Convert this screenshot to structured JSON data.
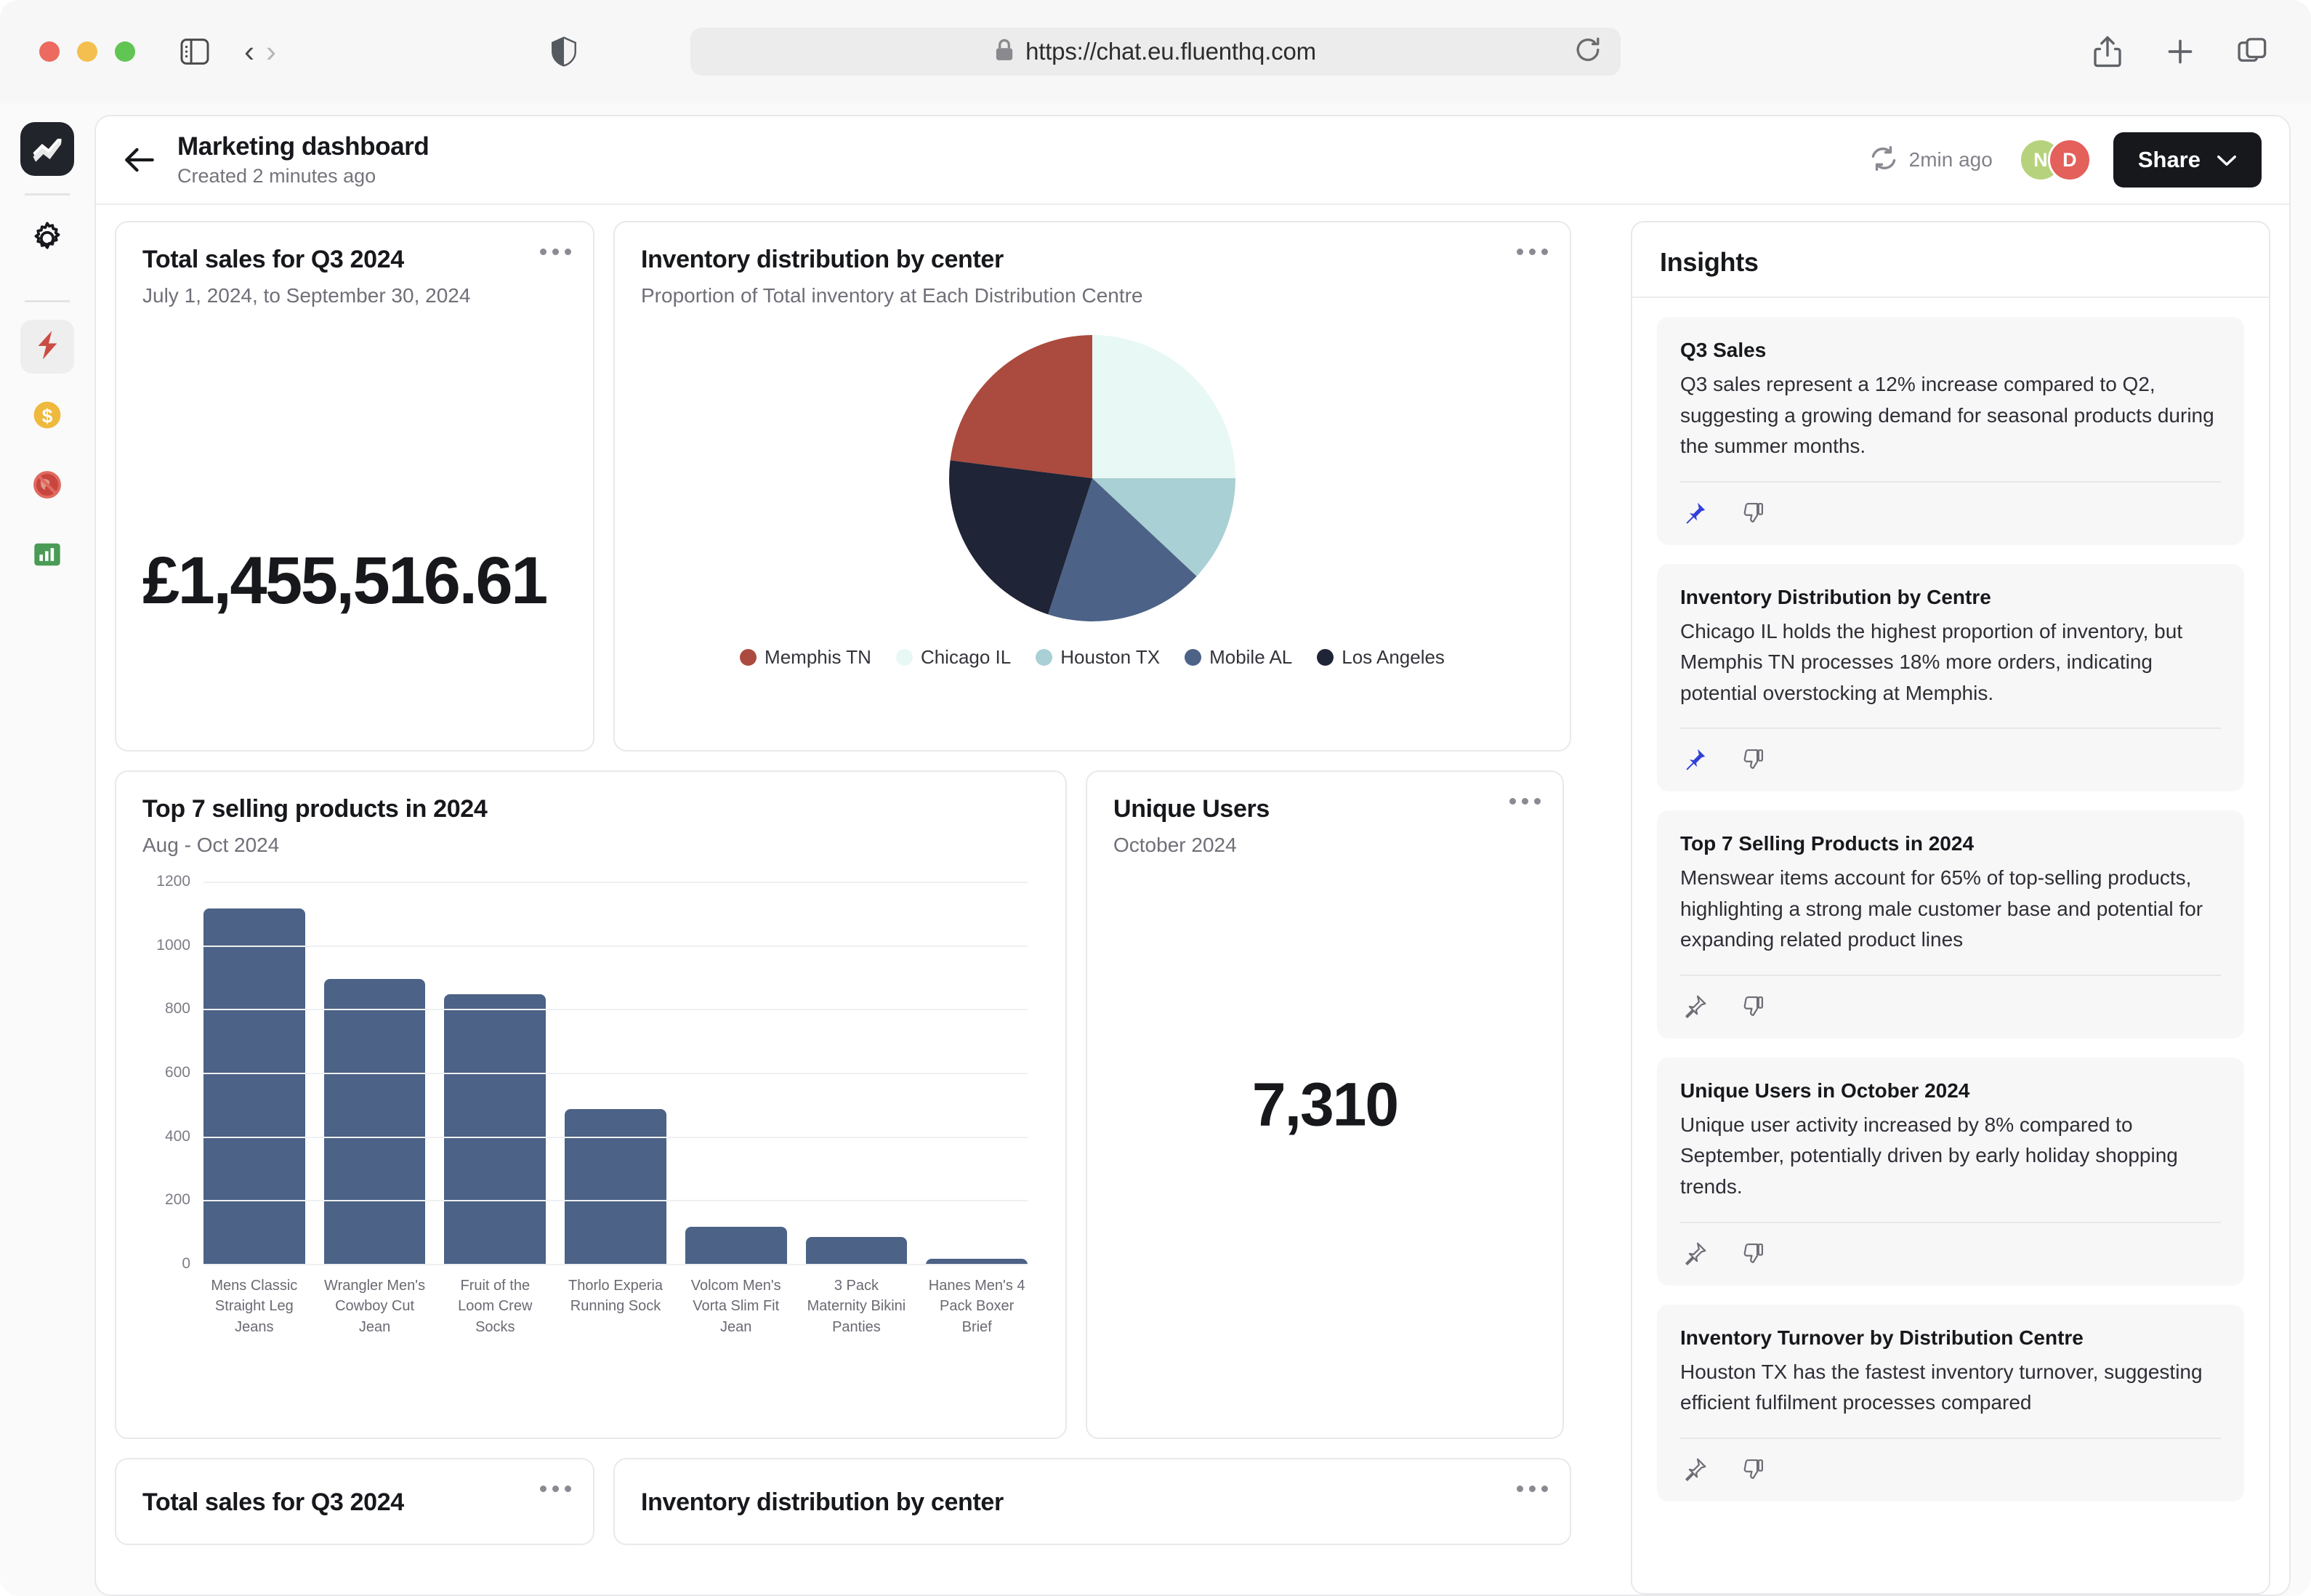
{
  "browser": {
    "url": "https://chat.eu.fluenthq.com",
    "lock_icon": "lock-icon",
    "reload_icon": "reload-icon",
    "shield_icon": "shield-icon",
    "sidebar_icon": "sidebar-toggle-icon",
    "back_icon": "chevron-left-icon",
    "forward_icon": "chevron-right-icon",
    "share_icon": "share-icon",
    "new_tab_icon": "plus-icon",
    "tabs_icon": "tab-overview-icon"
  },
  "rail": {
    "logo_icon": "fluent-logo-icon",
    "items": [
      {
        "icon": "gear-icon",
        "name": "settings",
        "active": false
      },
      {
        "icon": "lightning-bolt-icon",
        "name": "automations",
        "active": true
      },
      {
        "icon": "dollar-coin-icon",
        "name": "finance",
        "active": false
      },
      {
        "icon": "globe-restricted-icon",
        "name": "regions",
        "active": false
      },
      {
        "icon": "bar-chart-icon",
        "name": "analytics",
        "active": false
      }
    ]
  },
  "header": {
    "back_icon": "arrow-left-icon",
    "title": "Marketing dashboard",
    "subtitle": "Created 2 minutes ago",
    "refresh_icon": "refresh-icon",
    "refresh_label": "2min ago",
    "avatars": [
      {
        "initial": "N",
        "color": "#b7d27c"
      },
      {
        "initial": "D",
        "color": "#e4605a"
      }
    ],
    "share_label": "Share",
    "share_chevron": "chevron-down-icon"
  },
  "cards": {
    "total_sales": {
      "title": "Total sales for Q3 2024",
      "subtitle": "July 1, 2024, to September 30, 2024",
      "value": "£1,455,516.61",
      "menu_icon": "more-options-icon"
    },
    "inventory": {
      "title": "Inventory distribution by center",
      "subtitle": "Proportion of Total inventory at Each Distribution Centre",
      "menu_icon": "more-options-icon"
    },
    "top_products": {
      "title": "Top 7 selling products in 2024",
      "subtitle": "Aug - Oct 2024"
    },
    "unique_users": {
      "title": "Unique Users",
      "subtitle": "October 2024",
      "value": "7,310",
      "menu_icon": "more-options-icon"
    },
    "stub_total_sales": {
      "title": "Total sales for Q3 2024",
      "menu_icon": "more-options-icon"
    },
    "stub_inventory": {
      "title": "Inventory distribution by center",
      "menu_icon": "more-options-icon"
    }
  },
  "chart_data": [
    {
      "type": "pie",
      "title": "Inventory distribution by center",
      "subtitle": "Proportion of Total inventory at Each Distribution Centre",
      "legend_position": "bottom",
      "labels": [
        "Memphis TN",
        "Chicago IL",
        "Houston TX",
        "Mobile AL",
        "Los Angeles"
      ],
      "values": [
        23,
        25,
        12,
        18,
        22
      ],
      "colors": [
        "#ab4a3e",
        "#e8f8f4",
        "#a9d0d4",
        "#4c6286",
        "#1f2436"
      ],
      "slice_order_clockwise_from_top": [
        "Chicago IL",
        "Houston TX",
        "Mobile AL",
        "Los Angeles",
        "Memphis TN"
      ]
    },
    {
      "type": "bar",
      "title": "Top 7 selling products in 2024",
      "subtitle": "Aug - Oct 2024",
      "categories": [
        "Mens Classic Straight Leg Jeans",
        "Wrangler Men's Cowboy Cut Jean",
        "Fruit of the Loom Crew Socks",
        "Thorlo Experia Running Sock",
        "Volcom Men's Vorta Slim Fit Jean",
        "3 Pack Maternity Bikini Panties",
        "Hanes Men's 4 Pack Boxer Brief"
      ],
      "values": [
        1120,
        900,
        850,
        490,
        120,
        90,
        20
      ],
      "ylim": [
        0,
        1200
      ],
      "yticks": [
        0,
        200,
        400,
        600,
        800,
        1000,
        1200
      ],
      "xlabel": "",
      "ylabel": "",
      "grid": true,
      "bar_color": "#4c6286"
    }
  ],
  "insights": {
    "title": "Insights",
    "items": [
      {
        "title": "Q3 Sales",
        "body": "Q3 sales represent a 12% increase compared to Q2, suggesting a growing demand for seasonal products during the summer months.",
        "pinned": true,
        "pin_icon": "pin-icon",
        "dislike_icon": "thumbs-down-icon"
      },
      {
        "title": "Inventory Distribution by Centre",
        "body": "Chicago IL holds the highest proportion of inventory, but Memphis TN processes 18% more orders, indicating potential overstocking at Memphis.",
        "pinned": true,
        "pin_icon": "pin-icon",
        "dislike_icon": "thumbs-down-icon"
      },
      {
        "title": "Top 7 Selling Products in 2024",
        "body": "Menswear items account for 65% of top-selling products, highlighting a strong male customer base and potential for expanding related product lines",
        "pinned": false,
        "pin_icon": "pin-icon",
        "dislike_icon": "thumbs-down-icon"
      },
      {
        "title": "Unique Users in October 2024",
        "body": "Unique user activity increased by 8% compared to September, potentially driven by early holiday shopping trends.",
        "pinned": false,
        "pin_icon": "pin-icon",
        "dislike_icon": "thumbs-down-icon"
      },
      {
        "title": "Inventory Turnover by Distribution Centre",
        "body": "Houston TX has the fastest inventory turnover, suggesting efficient fulfilment processes compared",
        "pinned": false,
        "pin_icon": "pin-icon",
        "dislike_icon": "thumbs-down-icon"
      }
    ]
  },
  "colors": {
    "accent_dark": "#17181c",
    "bar": "#4c6286",
    "pin_active": "#3340d8"
  }
}
